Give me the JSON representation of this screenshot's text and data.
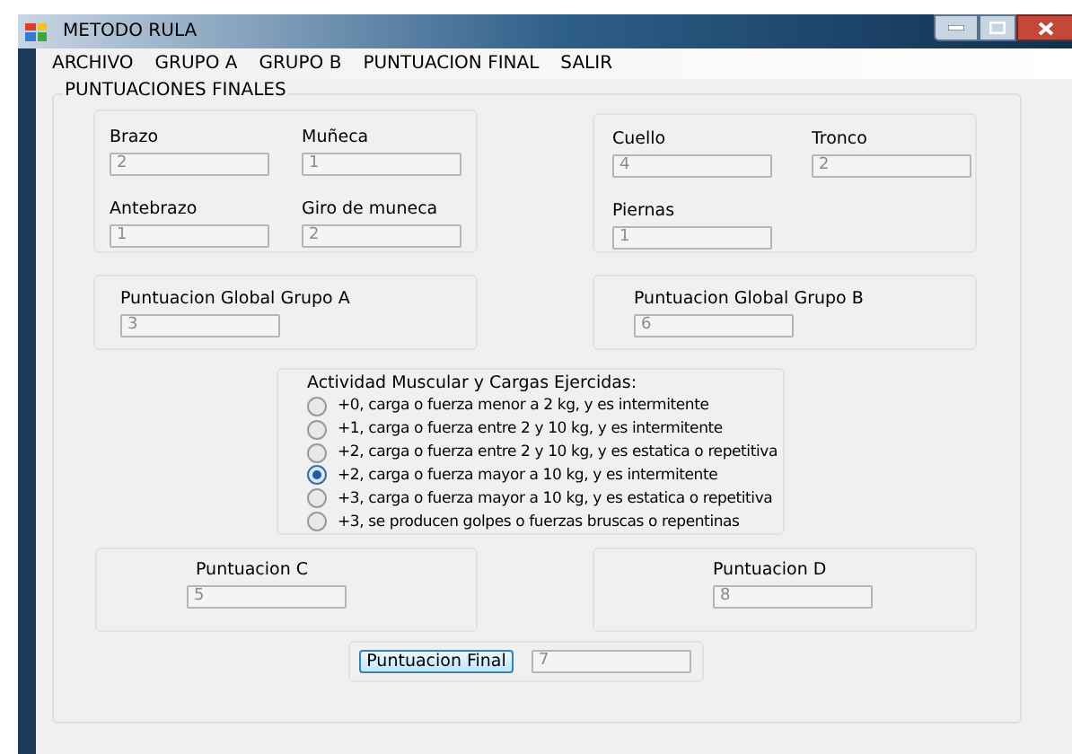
{
  "window": {
    "title": "METODO RULA"
  },
  "menu": [
    "ARCHIVO",
    "GRUPO A",
    "GRUPO B",
    "PUNTUACION FINAL",
    "SALIR"
  ],
  "panel": {
    "title": "PUNTUACIONES FINALES",
    "group_a": [
      {
        "label": "Brazo",
        "value": "2",
        "disabled": true
      },
      {
        "label": "Muñeca",
        "value": "1",
        "disabled": true
      },
      {
        "label": "Antebrazo",
        "value": "1",
        "disabled": true
      },
      {
        "label": "Giro de muneca",
        "value": "2",
        "disabled": true
      }
    ],
    "group_b": [
      {
        "label": "Cuello",
        "value": "4",
        "disabled": true
      },
      {
        "label": "Tronco",
        "value": "2",
        "disabled": true
      },
      {
        "label": "Piernas",
        "value": "1",
        "disabled": true
      }
    ],
    "global_a": {
      "label": "Puntuacion Global Grupo A",
      "value": "3",
      "disabled": true
    },
    "global_b": {
      "label": "Puntuacion Global Grupo B",
      "value": "6",
      "disabled": true
    },
    "activity": {
      "title": "Actividad Muscular y Cargas Ejercidas:",
      "options": [
        {
          "label": "+0, carga o fuerza menor a 2 kg, y es intermitente",
          "selected": false
        },
        {
          "label": "+1, carga o fuerza entre 2 y 10 kg, y es intermitente",
          "selected": false
        },
        {
          "label": "+2, carga o fuerza entre 2 y 10 kg, y es estatica o repetitiva",
          "selected": false
        },
        {
          "label": "+2, carga o fuerza mayor a 10 kg, y es intermitente",
          "selected": true
        },
        {
          "label": "+3, carga o fuerza mayor a 10 kg, y es estatica o repetitiva",
          "selected": false
        },
        {
          "label": "+3, se producen golpes o fuerzas bruscas o repentinas",
          "selected": false
        }
      ]
    },
    "score_c": {
      "label": "Puntuacion C",
      "value": "5",
      "disabled": true
    },
    "score_d": {
      "label": "Puntuacion D",
      "value": "8",
      "disabled": true
    },
    "final": {
      "button": "Puntuacion Final",
      "value": "7",
      "disabled": true
    }
  }
}
